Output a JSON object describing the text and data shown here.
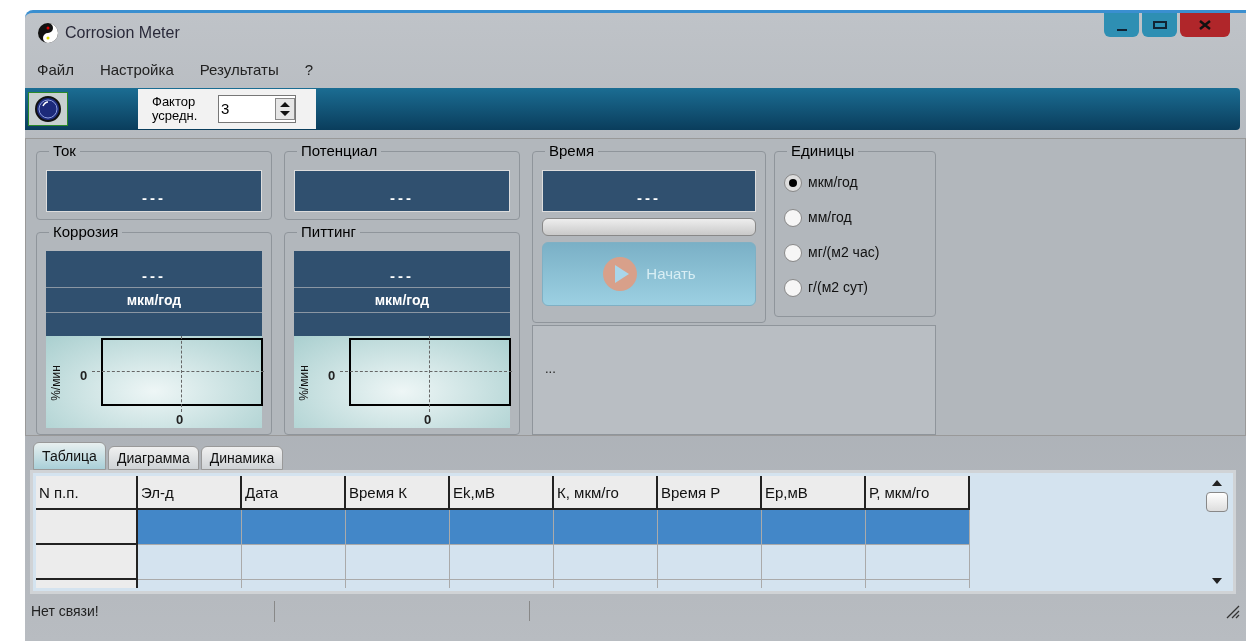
{
  "window": {
    "title": "Corrosion Meter"
  },
  "menu": [
    {
      "label": "Файл"
    },
    {
      "label": "Настройка"
    },
    {
      "label": "Результаты"
    },
    {
      "label": "?"
    }
  ],
  "toolbar": {
    "factor": {
      "label": "Фактор усредн.",
      "value": "3"
    }
  },
  "readouts": [
    {
      "title": "Ток",
      "value": "---"
    },
    {
      "title": "Потенциал",
      "value": "---"
    }
  ],
  "rate_panels": [
    {
      "title": "Коррозия",
      "value": "---",
      "unit": "мкм/год",
      "chart": {
        "ylabel": "%/мин",
        "ytick": "0",
        "xtick": "0"
      }
    },
    {
      "title": "Питтинг",
      "value": "---",
      "unit": "мкм/год",
      "chart": {
        "ylabel": "%/мин",
        "ytick": "0",
        "xtick": "0"
      }
    }
  ],
  "time": {
    "title": "Время",
    "value": "---",
    "progress": {
      "level": 0
    },
    "start_button": {
      "label": "Начать",
      "disabled": true
    }
  },
  "units": {
    "title": "Единицы",
    "options": [
      {
        "label": "мкм/год",
        "selected": true
      },
      {
        "label": "мм/год",
        "selected": false
      },
      {
        "label": "мг/(м2 час)",
        "selected": false
      },
      {
        "label": "г/(м2 сут)",
        "selected": false
      }
    ]
  },
  "info": {
    "text": "..."
  },
  "tabs": [
    {
      "label": "Таблица",
      "selected": true
    },
    {
      "label": "Диаграмма",
      "selected": false
    },
    {
      "label": "Динамика",
      "selected": false
    }
  ],
  "table": {
    "columns": [
      "N п.п.",
      "Эл-д",
      "Дата",
      "Время К",
      "Ek,мВ",
      "К, мкм/го",
      "Время Р",
      "Ep,мВ",
      "Р, мкм/го"
    ],
    "rows": [
      {
        "selected": true
      },
      {
        "selected": false
      },
      {
        "selected": false
      }
    ]
  },
  "status_bar": {
    "message": "Нет связи!"
  }
}
